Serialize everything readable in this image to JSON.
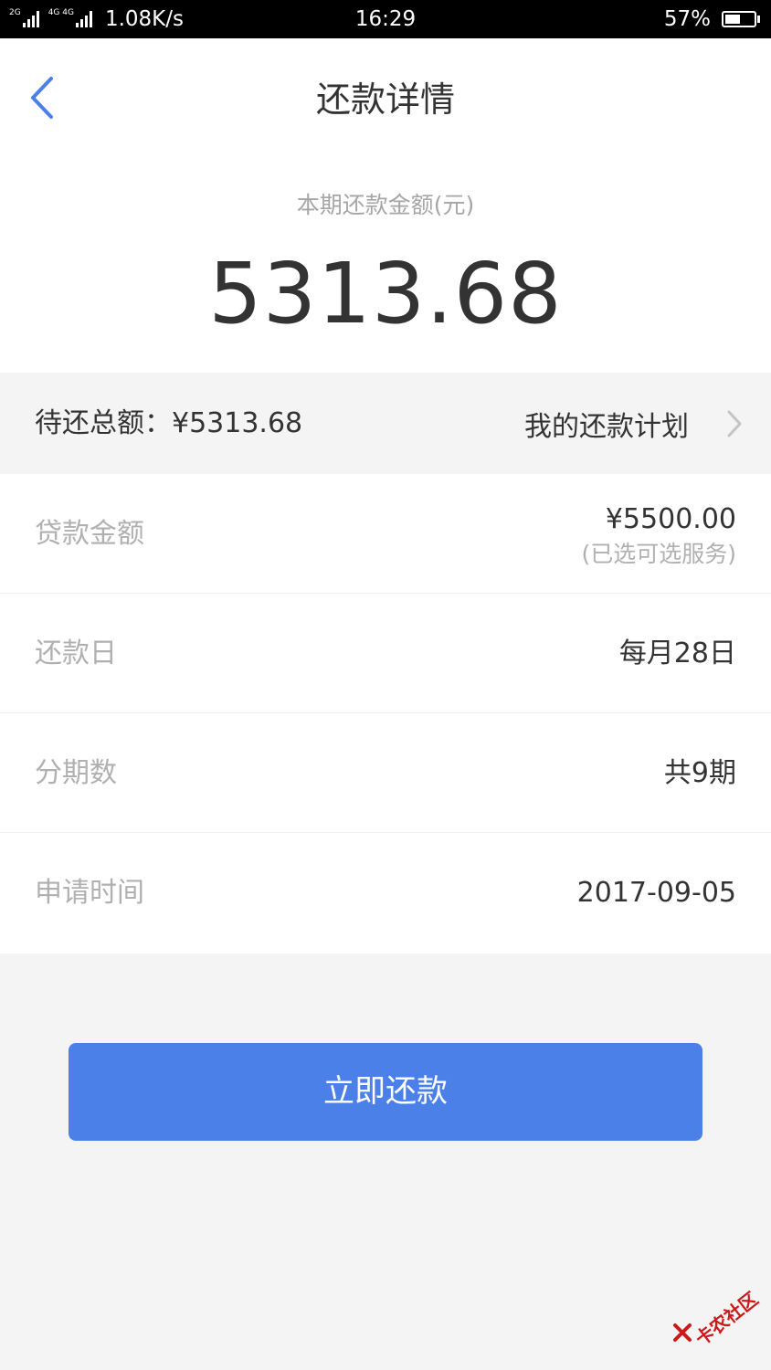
{
  "status_bar": {
    "net_1": "2G",
    "net_2": "4G 4G",
    "speed": "1.08K/s",
    "time": "16:29",
    "battery_pct": "57%",
    "battery_level": 0.57
  },
  "header": {
    "back_icon": "chevron-left-icon",
    "title": "还款详情"
  },
  "amount": {
    "label": "本期还款金额(元)",
    "value": "5313.68"
  },
  "summary": {
    "total": "待还总额：¥5313.68",
    "plan_link": "我的还款计划",
    "plan_icon": "chevron-right-icon"
  },
  "details": [
    {
      "label": "贷款金额",
      "value": "¥5500.00",
      "sub": "(已选可选服务)"
    },
    {
      "label": "还款日",
      "value": "每月28日"
    },
    {
      "label": "分期数",
      "value": "共9期"
    },
    {
      "label": "申请时间",
      "value": "2017-09-05"
    }
  ],
  "pay_button": {
    "label": "立即还款"
  },
  "watermark": {
    "text": "卡农社区"
  },
  "colors": {
    "accent": "#4a80e8",
    "page_bg": "#f4f4f4",
    "text_primary": "#333333",
    "text_secondary": "#b0b0b0",
    "watermark_red": "#cc1a1a"
  }
}
